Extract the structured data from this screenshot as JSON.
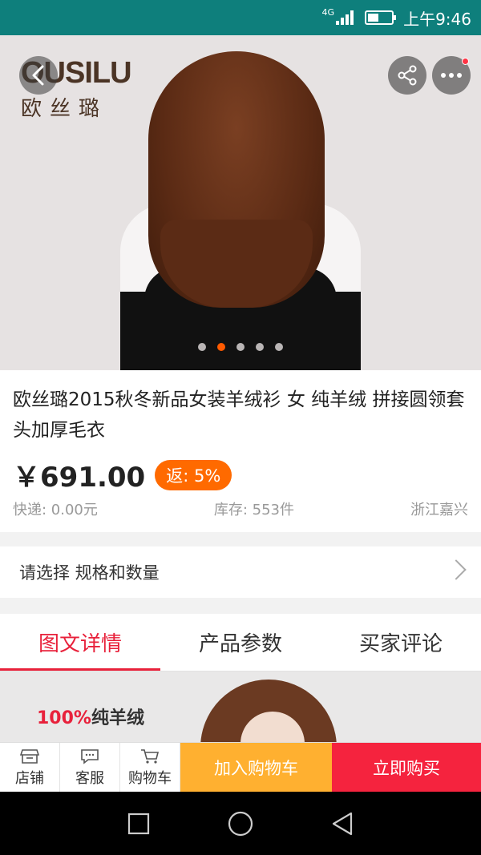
{
  "status_bar": {
    "network": "4G",
    "time": "上午9:46",
    "battery_level": 0.45
  },
  "hero": {
    "brand_latin": "OUSILU",
    "brand_cn": "欧丝璐",
    "carousel_total": 5,
    "carousel_active_index": 1
  },
  "product": {
    "title": "欧丝璐2015秋冬新品女装羊绒衫 女 纯羊绒 拼接圆领套头加厚毛衣",
    "price": "￥691.00",
    "rebate": "返: 5%",
    "shipping": "快递: 0.00元",
    "stock": "库存: 553件",
    "location": "浙江嘉兴"
  },
  "spec": {
    "label": "请选择 规格和数量"
  },
  "tabs": [
    {
      "label": "图文详情",
      "active": true
    },
    {
      "label": "产品参数",
      "active": false
    },
    {
      "label": "买家评论",
      "active": false
    }
  ],
  "detail": {
    "pct": "100%",
    "text": "纯羊绒"
  },
  "bottom_bar": {
    "shop": "店铺",
    "service": "客服",
    "cart": "购物车",
    "add_to_cart": "加入购物车",
    "buy_now": "立即购买"
  },
  "colors": {
    "status_bar": "#0e7f7c",
    "accent_red": "#e8213b",
    "rebate_orange": "#ff6a00",
    "add_cart_yellow": "#ffb030",
    "buy_red": "#f5233e"
  },
  "icons": [
    "back-icon",
    "share-icon",
    "more-icon",
    "chevron-right-icon",
    "shop-icon",
    "chat-icon",
    "cart-icon",
    "square-icon",
    "circle-icon",
    "triangle-back-icon"
  ]
}
